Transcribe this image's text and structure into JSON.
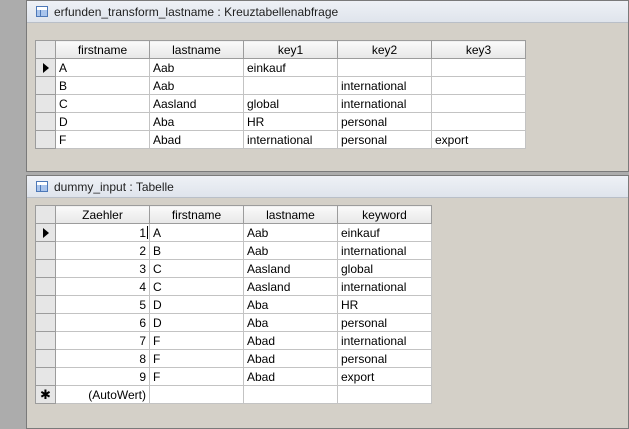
{
  "window1": {
    "title": "erfunden_transform_lastname : Kreuztabellenabfrage",
    "columns": [
      "firstname",
      "lastname",
      "key1",
      "key2",
      "key3"
    ],
    "rows": [
      [
        "A",
        "Aab",
        "einkauf",
        "",
        ""
      ],
      [
        "B",
        "Aab",
        "",
        "international",
        ""
      ],
      [
        "C",
        "Aasland",
        "global",
        "international",
        ""
      ],
      [
        "D",
        "Aba",
        "HR",
        "personal",
        ""
      ],
      [
        "F",
        "Abad",
        "international",
        "personal",
        "export"
      ]
    ]
  },
  "window2": {
    "title": "dummy_input : Tabelle",
    "columns": [
      "Zaehler",
      "firstname",
      "lastname",
      "keyword"
    ],
    "rows": [
      [
        "1",
        "A",
        "Aab",
        "einkauf"
      ],
      [
        "2",
        "B",
        "Aab",
        "international"
      ],
      [
        "3",
        "C",
        "Aasland",
        "global"
      ],
      [
        "4",
        "C",
        "Aasland",
        "international"
      ],
      [
        "5",
        "D",
        "Aba",
        "HR"
      ],
      [
        "6",
        "D",
        "Aba",
        "personal"
      ],
      [
        "7",
        "F",
        "Abad",
        "international"
      ],
      [
        "8",
        "F",
        "Abad",
        "personal"
      ],
      [
        "9",
        "F",
        "Abad",
        "export"
      ]
    ],
    "new_record": "(AutoWert)"
  },
  "icons": {
    "current_record": "arrow-right-icon",
    "new_record": "asterisk-icon",
    "table": "table-icon"
  }
}
